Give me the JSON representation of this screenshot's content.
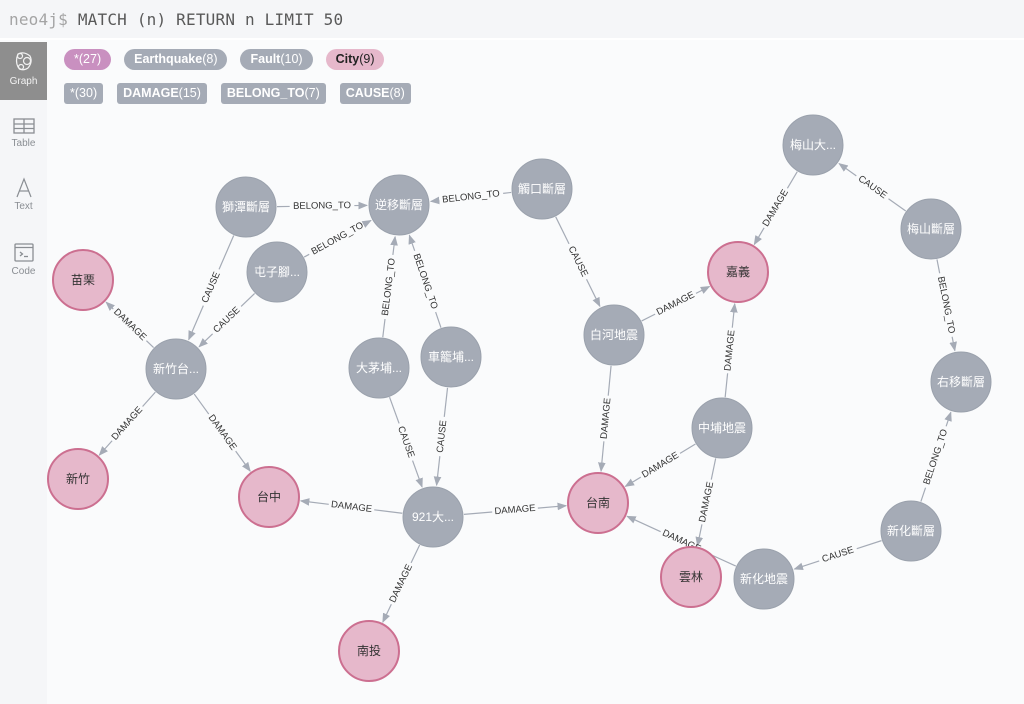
{
  "query": {
    "prompt": "neo4j$",
    "text": "MATCH (n) RETURN n LIMIT 50"
  },
  "sidebar": {
    "items": [
      {
        "label": "Graph",
        "icon": "graph-icon",
        "active": true
      },
      {
        "label": "Table",
        "icon": "table-icon",
        "active": false
      },
      {
        "label": "Text",
        "icon": "text-icon",
        "active": false
      },
      {
        "label": "Code",
        "icon": "code-icon",
        "active": false
      }
    ]
  },
  "legend": {
    "node_labels": [
      {
        "name": "*",
        "count": "(27)",
        "color": "#c990c0",
        "text_color": "#ffffff"
      },
      {
        "name": "Earthquake",
        "count": "(8)",
        "color": "#a5abb6",
        "text_color": "#ffffff"
      },
      {
        "name": "Fault",
        "count": "(10)",
        "color": "#a5abb6",
        "text_color": "#ffffff"
      },
      {
        "name": "City",
        "count": "(9)",
        "color": "#e6b8cb",
        "text_color": "#222222"
      }
    ],
    "relationship_types": [
      {
        "name": "*",
        "count": "(30)",
        "color": "#a5abb6"
      },
      {
        "name": "DAMAGE",
        "count": "(15)",
        "color": "#a5abb6"
      },
      {
        "name": "BELONG_TO",
        "count": "(7)",
        "color": "#a5abb6"
      },
      {
        "name": "CAUSE",
        "count": "(8)",
        "color": "#a5abb6"
      }
    ]
  },
  "graph": {
    "colors": {
      "gray_fill": "#a5abb6",
      "gray_stroke": "#9aa1ac",
      "city_fill": "#e6b8cb",
      "city_stroke": "#cc6f90",
      "edge": "#a5abb6"
    },
    "nodes": [
      {
        "id": "n1",
        "label": "獅潭斷層",
        "type": "Fault"
      },
      {
        "id": "n2",
        "label": "逆移斷層",
        "type": "Fault"
      },
      {
        "id": "n3",
        "label": "觸口斷層",
        "type": "Fault"
      },
      {
        "id": "n4",
        "label": "屯子腳...",
        "type": "Fault"
      },
      {
        "id": "n5",
        "label": "苗栗",
        "type": "City"
      },
      {
        "id": "n6",
        "label": "新竹台...",
        "type": "Earthquake"
      },
      {
        "id": "n7",
        "label": "大茅埔...",
        "type": "Fault"
      },
      {
        "id": "n8",
        "label": "車籠埔...",
        "type": "Fault"
      },
      {
        "id": "n9",
        "label": "新竹",
        "type": "City"
      },
      {
        "id": "n10",
        "label": "台中",
        "type": "City"
      },
      {
        "id": "n11",
        "label": "921大...",
        "type": "Earthquake"
      },
      {
        "id": "n12",
        "label": "南投",
        "type": "City"
      },
      {
        "id": "n13",
        "label": "白河地震",
        "type": "Earthquake"
      },
      {
        "id": "n14",
        "label": "嘉義",
        "type": "City"
      },
      {
        "id": "n15",
        "label": "梅山大...",
        "type": "Earthquake"
      },
      {
        "id": "n16",
        "label": "梅山斷層",
        "type": "Fault"
      },
      {
        "id": "n17",
        "label": "右移斷層",
        "type": "Fault"
      },
      {
        "id": "n18",
        "label": "中埔地震",
        "type": "Earthquake"
      },
      {
        "id": "n19",
        "label": "台南",
        "type": "City"
      },
      {
        "id": "n20",
        "label": "雲林",
        "type": "City"
      },
      {
        "id": "n21",
        "label": "新化地震",
        "type": "Earthquake"
      },
      {
        "id": "n22",
        "label": "新化斷層",
        "type": "Fault"
      }
    ],
    "edges": [
      {
        "from": "n1",
        "to": "n2",
        "type": "BELONG_TO"
      },
      {
        "from": "n4",
        "to": "n2",
        "type": "BELONG_TO"
      },
      {
        "from": "n3",
        "to": "n2",
        "type": "BELONG_TO"
      },
      {
        "from": "n7",
        "to": "n2",
        "type": "BELONG_TO"
      },
      {
        "from": "n8",
        "to": "n2",
        "type": "BELONG_TO"
      },
      {
        "from": "n1",
        "to": "n6",
        "type": "CAUSE"
      },
      {
        "from": "n4",
        "to": "n6",
        "type": "CAUSE"
      },
      {
        "from": "n6",
        "to": "n5",
        "type": "DAMAGE"
      },
      {
        "from": "n6",
        "to": "n9",
        "type": "DAMAGE"
      },
      {
        "from": "n6",
        "to": "n10",
        "type": "DAMAGE"
      },
      {
        "from": "n7",
        "to": "n11",
        "type": "CAUSE"
      },
      {
        "from": "n8",
        "to": "n11",
        "type": "CAUSE"
      },
      {
        "from": "n11",
        "to": "n10",
        "type": "DAMAGE"
      },
      {
        "from": "n11",
        "to": "n12",
        "type": "DAMAGE"
      },
      {
        "from": "n11",
        "to": "n19",
        "type": "DAMAGE"
      },
      {
        "from": "n3",
        "to": "n13",
        "type": "CAUSE"
      },
      {
        "from": "n13",
        "to": "n14",
        "type": "DAMAGE"
      },
      {
        "from": "n13",
        "to": "n19",
        "type": "DAMAGE"
      },
      {
        "from": "n15",
        "to": "n14",
        "type": "DAMAGE"
      },
      {
        "from": "n16",
        "to": "n15",
        "type": "CAUSE"
      },
      {
        "from": "n16",
        "to": "n17",
        "type": "BELONG_TO"
      },
      {
        "from": "n18",
        "to": "n14",
        "type": "DAMAGE"
      },
      {
        "from": "n18",
        "to": "n19",
        "type": "DAMAGE"
      },
      {
        "from": "n18",
        "to": "n20",
        "type": "DAMAGE"
      },
      {
        "from": "n21",
        "to": "n19",
        "type": "DAMAGE"
      },
      {
        "from": "n22",
        "to": "n21",
        "type": "CAUSE"
      },
      {
        "from": "n22",
        "to": "n17",
        "type": "BELONG_TO"
      }
    ]
  }
}
